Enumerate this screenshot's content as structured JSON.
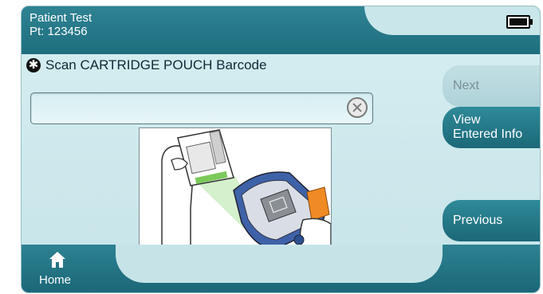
{
  "header": {
    "line1": "Patient Test",
    "line2": "Pt: 123456",
    "battery_level": 1.0,
    "battery_icon": "battery-full-icon"
  },
  "instruction": {
    "icon": "asterisk-icon",
    "text": "Scan CARTRIDGE POUCH Barcode"
  },
  "barcode_input": {
    "value": "",
    "placeholder": "",
    "clear_icon": "clear-x-icon"
  },
  "illustration": {
    "icon": "scan-cartridge-pouch-illustration"
  },
  "side_buttons": {
    "next_label": "Next",
    "view_line1": "View",
    "view_line2": "Entered Info",
    "previous_label": "Previous"
  },
  "footer": {
    "home_label": "Home",
    "home_icon": "home-icon"
  },
  "colors": {
    "bar_teal": "#1e6e7e",
    "background": "#cbe7eb",
    "disabled_button": "#b4d6db"
  }
}
